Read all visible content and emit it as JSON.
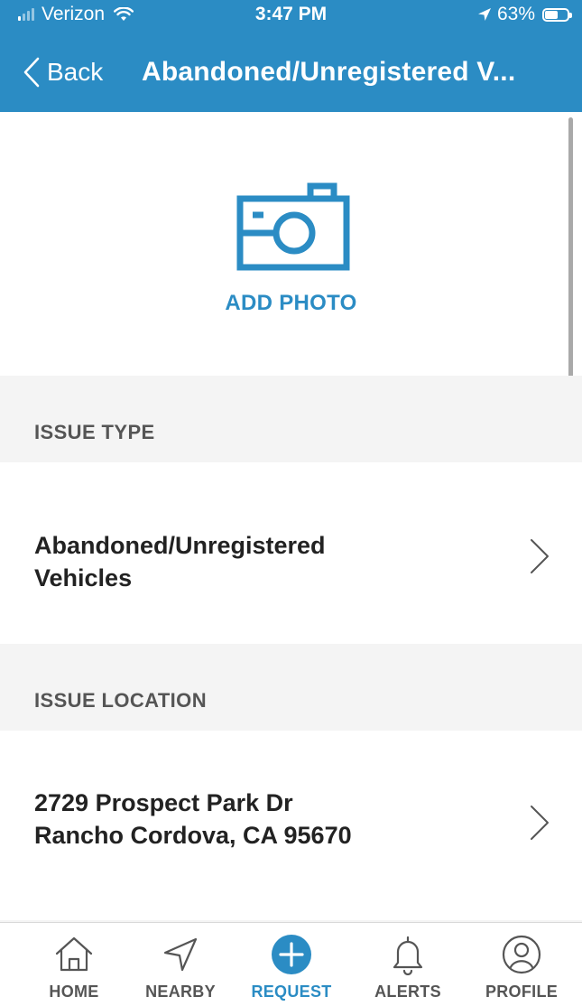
{
  "status_bar": {
    "carrier": "Verizon",
    "time": "3:47 PM",
    "battery_percent": "63%",
    "battery_level": 0.63
  },
  "nav": {
    "back_label": "Back",
    "title": "Abandoned/Unregistered V..."
  },
  "photo": {
    "add_photo_label": "ADD PHOTO",
    "icon": "camera-icon"
  },
  "issue_type": {
    "header": "ISSUE TYPE",
    "value_line1": "Abandoned/Unregistered",
    "value_line2": "Vehicles"
  },
  "issue_location": {
    "header": "ISSUE LOCATION",
    "address_line1": "2729 Prospect Park Dr",
    "address_line2": "Rancho Cordova, CA 95670"
  },
  "tab_bar": {
    "active": "request",
    "tabs": [
      {
        "id": "home",
        "label": "HOME",
        "icon": "home-icon"
      },
      {
        "id": "nearby",
        "label": "NEARBY",
        "icon": "location-arrow-icon"
      },
      {
        "id": "request",
        "label": "REQUEST",
        "icon": "plus-circle-icon"
      },
      {
        "id": "alerts",
        "label": "ALERTS",
        "icon": "bell-icon"
      },
      {
        "id": "profile",
        "label": "PROFILE",
        "icon": "user-circle-icon"
      }
    ]
  },
  "colors": {
    "primary": "#2b8cc4",
    "section_bg": "#f4f4f4",
    "text_dark": "#222222",
    "text_muted": "#555555"
  }
}
